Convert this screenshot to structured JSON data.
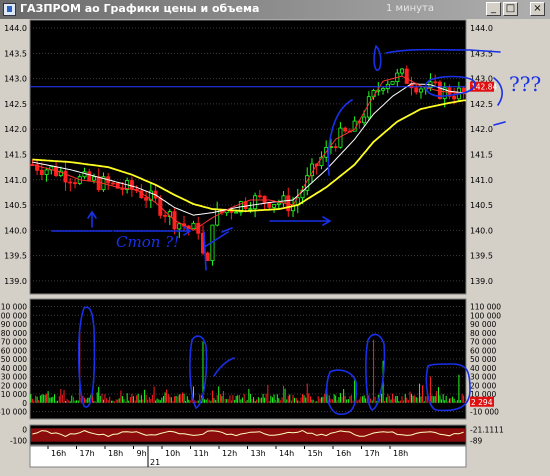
{
  "window": {
    "title": "ГАЗПРОМ ао Графики цены и объема",
    "timeframe": "1 минута",
    "minimize_glyph": "_",
    "maximize_glyph": "□",
    "close_glyph": "×"
  },
  "colors": {
    "background": "#000000",
    "grid": "#3a3a3a",
    "up_candle": "#22ff22",
    "down_candle": "#ff2020",
    "ma_fast": "#ff3030",
    "ma_mid": "#ffffff",
    "ma_slow": "#ffff22",
    "hline": "#2a3aff",
    "annotation": "#1830e8",
    "osc_line": "#ffffc0"
  },
  "chart_data": [
    {
      "type": "candlestick",
      "y_ticks": [
        "144.0",
        "143.5",
        "143.0",
        "142.5",
        "142.0",
        "141.5",
        "141.0",
        "140.5",
        "140.0",
        "139.5",
        "139.0"
      ],
      "ylim": [
        138.8,
        144.1
      ],
      "last_price": "142.84",
      "hline": 142.84,
      "ma_slow_points": [
        [
          0,
          141.4
        ],
        [
          8,
          141.35
        ],
        [
          16,
          141.25
        ],
        [
          21,
          141.1
        ],
        [
          26,
          140.9
        ],
        [
          30,
          140.7
        ],
        [
          34,
          140.52
        ],
        [
          38,
          140.42
        ],
        [
          45,
          140.38
        ],
        [
          52,
          140.42
        ],
        [
          56,
          140.5
        ],
        [
          62,
          140.85
        ],
        [
          68,
          141.3
        ],
        [
          72,
          141.75
        ],
        [
          77,
          142.15
        ],
        [
          82,
          142.4
        ],
        [
          88,
          142.52
        ],
        [
          91,
          142.57
        ]
      ],
      "ma_mid_points": [
        [
          0,
          141.35
        ],
        [
          8,
          141.2
        ],
        [
          14,
          141.05
        ],
        [
          18,
          140.95
        ],
        [
          22,
          140.85
        ],
        [
          26,
          140.7
        ],
        [
          30,
          140.45
        ],
        [
          34,
          140.3
        ],
        [
          38,
          140.35
        ],
        [
          43,
          140.45
        ],
        [
          50,
          140.55
        ],
        [
          55,
          140.6
        ],
        [
          62,
          141.2
        ],
        [
          68,
          141.8
        ],
        [
          72,
          142.3
        ],
        [
          76,
          142.65
        ],
        [
          80,
          142.9
        ],
        [
          84,
          142.88
        ],
        [
          88,
          142.75
        ],
        [
          91,
          142.72
        ]
      ],
      "ma_fast_points": [
        [
          0,
          141.3
        ],
        [
          6,
          141.15
        ],
        [
          10,
          141.0
        ],
        [
          14,
          140.95
        ],
        [
          18,
          140.85
        ],
        [
          22,
          140.8
        ],
        [
          26,
          140.55
        ],
        [
          30,
          140.2
        ],
        [
          34,
          140.0
        ],
        [
          38,
          140.25
        ],
        [
          42,
          140.45
        ],
        [
          46,
          140.6
        ],
        [
          50,
          140.6
        ],
        [
          55,
          140.5
        ],
        [
          60,
          141.3
        ],
        [
          64,
          141.8
        ],
        [
          68,
          142.0
        ],
        [
          71,
          142.5
        ],
        [
          74,
          142.95
        ],
        [
          78,
          143.05
        ],
        [
          82,
          142.85
        ],
        [
          86,
          142.75
        ],
        [
          91,
          142.7
        ]
      ],
      "notes": [
        "Стоп ?!",
        "???"
      ]
    },
    {
      "type": "bar",
      "y_ticks": [
        "110 000",
        "100 000",
        "90 000",
        "80 000",
        "70 000",
        "60 000",
        "50 000",
        "40 000",
        "30 000",
        "20 000",
        "10 000",
        "0",
        "-10 000"
      ],
      "ylim": [
        -14000,
        114000
      ],
      "last_value": "2 294",
      "spikes": [
        [
          10,
          85000
        ],
        [
          36,
          70000
        ],
        [
          58,
          22000
        ],
        [
          68,
          28000
        ],
        [
          72,
          72000
        ],
        [
          74,
          48000
        ],
        [
          84,
          30000
        ],
        [
          90,
          32000
        ]
      ]
    },
    {
      "type": "line",
      "y_ticks": [
        "0",
        "-100"
      ],
      "ylim": [
        -120,
        20
      ],
      "right_values": [
        "-21.1111",
        "-89"
      ]
    }
  ],
  "x_labels": [
    "16h",
    "17h",
    "18h",
    "9h",
    "10h",
    "11h",
    "12h",
    "13h",
    "14h",
    "15h",
    "16h",
    "17h",
    "18h"
  ],
  "date_labels": [
    "20",
    "21"
  ]
}
